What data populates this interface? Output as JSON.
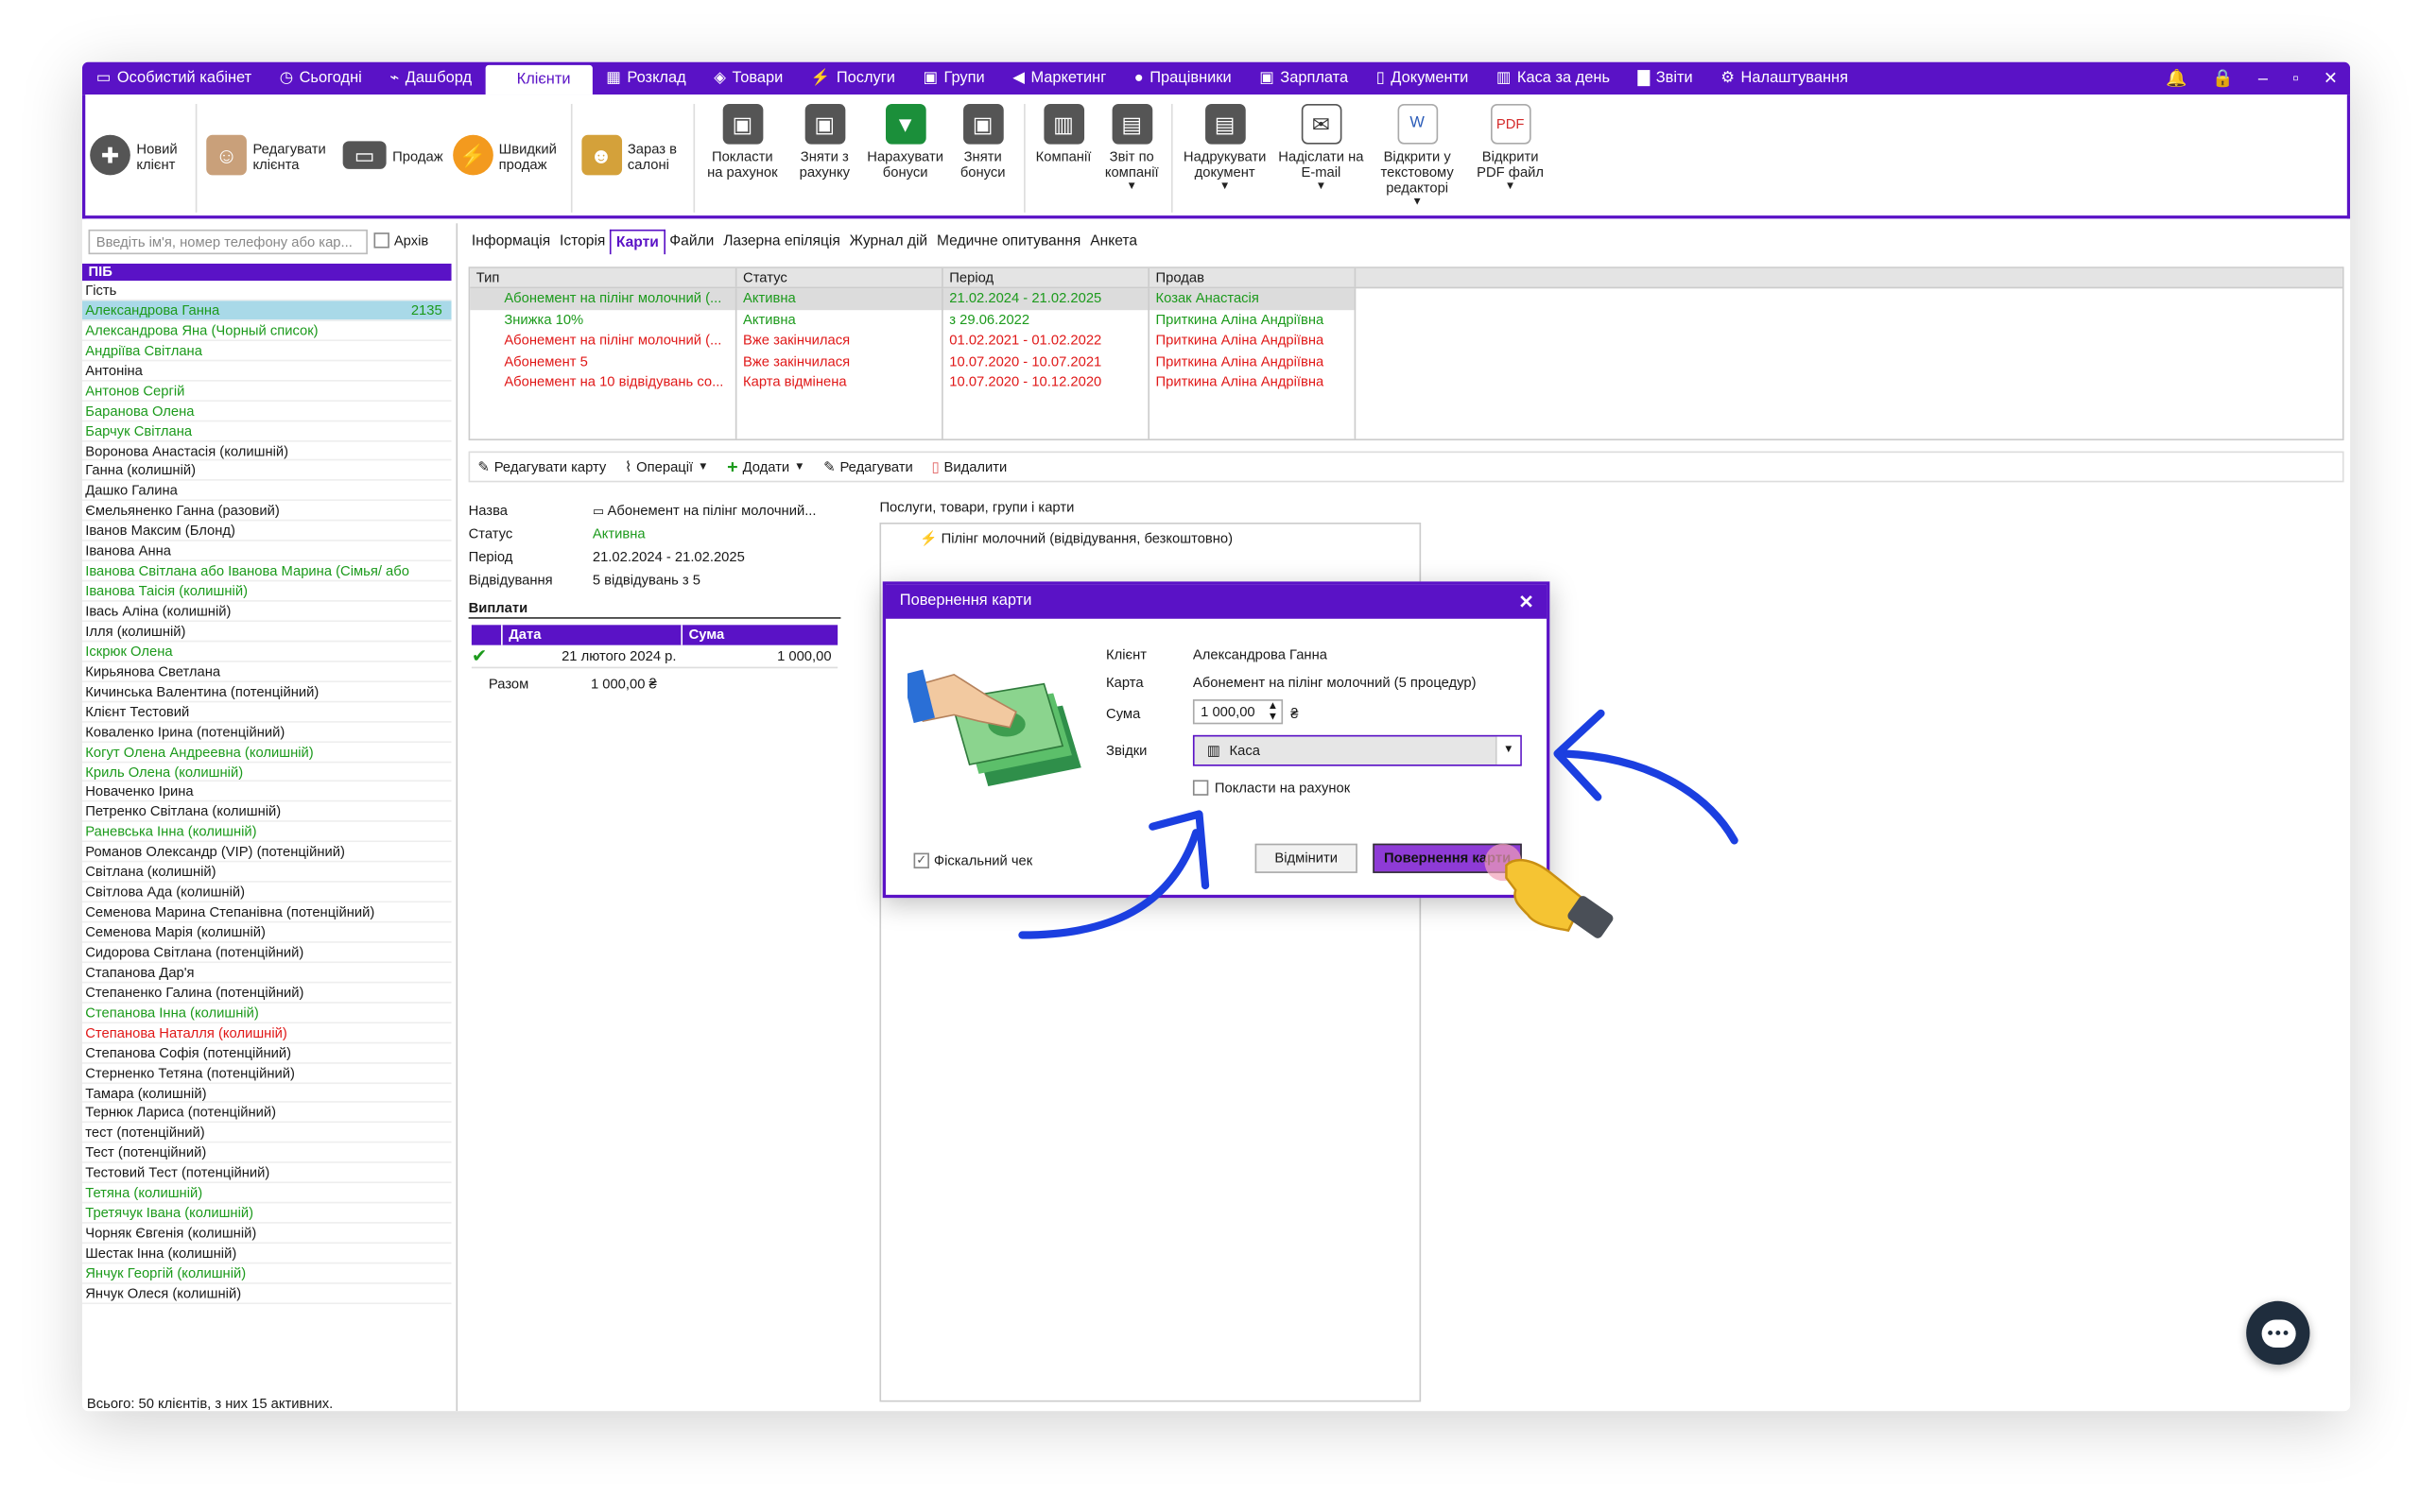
{
  "menubar": {
    "tabs": [
      {
        "label": "Особистий кабінет",
        "icon": "cabinet-icon",
        "glyph": "▭"
      },
      {
        "label": "Сьогодні",
        "icon": "clock-icon",
        "glyph": "◷"
      },
      {
        "label": "Дашборд",
        "icon": "pulse-icon",
        "glyph": "⌁"
      },
      {
        "label": "Клієнти",
        "icon": "",
        "glyph": "",
        "active": true
      },
      {
        "label": "Розклад",
        "icon": "calendar-icon",
        "glyph": "▦"
      },
      {
        "label": "Товари",
        "icon": "box-icon",
        "glyph": "◈"
      },
      {
        "label": "Послуги",
        "icon": "lightning-icon",
        "glyph": "⚡"
      },
      {
        "label": "Групи",
        "icon": "groups-icon",
        "glyph": "▣"
      },
      {
        "label": "Маркетинг",
        "icon": "megaphone-icon",
        "glyph": "◀"
      },
      {
        "label": "Працівники",
        "icon": "person-icon",
        "glyph": "●"
      },
      {
        "label": "Зарплата",
        "icon": "money-icon",
        "glyph": "▣"
      },
      {
        "label": "Документи",
        "icon": "document-icon",
        "glyph": "▯"
      },
      {
        "label": "Каса за день",
        "icon": "calculator-icon",
        "glyph": "▥"
      },
      {
        "label": "Звіти",
        "icon": "bar-chart-icon",
        "glyph": "▇"
      },
      {
        "label": "Налаштування",
        "icon": "gear-icon",
        "glyph": "⚙"
      }
    ],
    "window_controls": [
      "🔔",
      "🔒",
      "–",
      "▫",
      "✕"
    ]
  },
  "ribbon": {
    "new_client": "Новий клієнт",
    "edit_client": "Редагувати клієнта",
    "sale": "Продаж",
    "quick_sale": "Швидкий продаж",
    "in_salon": "Зараз в салоні",
    "put_on_account": "Покласти на рахунок",
    "withdraw_account": "Зняти з рахунку",
    "accrue_bonus": "Нарахувати бонуси",
    "withdraw_bonus": "Зняти бонуси",
    "companies": "Компанії",
    "companies_report": "Звіт по компанії",
    "print_document": "Надрукувати документ",
    "send_email": "Надіслати на E-mail",
    "open_text_editor": "Відкрити у текстовому редакторі",
    "open_pdf": "Відкрити PDF файл"
  },
  "sidebar": {
    "search_placeholder": "Введіть ім'я, номер телефону або кар...",
    "archive_label": "Архів",
    "header": "ПІБ",
    "clients": [
      {
        "name": "Гість",
        "color": "#1a1a1a"
      },
      {
        "name": "Александрова Ганна",
        "color": "#1c9a1c",
        "count": "2135",
        "selected": true
      },
      {
        "name": "Александрова Яна (Чорный список)",
        "color": "#1c9a1c"
      },
      {
        "name": "Андріїва Світлана",
        "color": "#1c9a1c"
      },
      {
        "name": "Антоніна",
        "color": "#1a1a1a"
      },
      {
        "name": "Антонов Сергій",
        "color": "#1c9a1c"
      },
      {
        "name": "Баранова Олена",
        "color": "#1c9a1c"
      },
      {
        "name": "Барчук Світлана",
        "color": "#1c9a1c"
      },
      {
        "name": "Воронова Анастасія (колишній)",
        "color": "#1a1a1a"
      },
      {
        "name": "Ганна (колишній)",
        "color": "#1a1a1a"
      },
      {
        "name": "Дашко Галина",
        "color": "#1a1a1a"
      },
      {
        "name": "Ємельяненко Ганна (разовий)",
        "color": "#1a1a1a"
      },
      {
        "name": "Іванов Максим (Блонд)",
        "color": "#1a1a1a"
      },
      {
        "name": "Іванова Анна",
        "color": "#1a1a1a"
      },
      {
        "name": "Іванова Світлана  або Іванова  Марина (Сімья/  або",
        "color": "#1c9a1c"
      },
      {
        "name": "Іванова Таісія (колишній)",
        "color": "#1c9a1c"
      },
      {
        "name": "Івась Аліна (колишній)",
        "color": "#1a1a1a"
      },
      {
        "name": "Ілля (колишній)",
        "color": "#1a1a1a"
      },
      {
        "name": "Іскрюк Олена",
        "color": "#1c9a1c"
      },
      {
        "name": "Кирьянова Светлана",
        "color": "#1a1a1a"
      },
      {
        "name": "Кичинська Валентина (потенційний)",
        "color": "#1a1a1a"
      },
      {
        "name": "Клієнт Тестовий",
        "color": "#1a1a1a"
      },
      {
        "name": "Коваленко Ірина (потенційний)",
        "color": "#1a1a1a"
      },
      {
        "name": "Когут Олена Андреевна (колишній)",
        "color": "#1c9a1c"
      },
      {
        "name": "Криль Олена (колишній)",
        "color": "#1c9a1c"
      },
      {
        "name": "Новаченко Ірина",
        "color": "#1a1a1a"
      },
      {
        "name": "Петренко Світлана (колишній)",
        "color": "#1a1a1a"
      },
      {
        "name": "Раневська Інна (колишній)",
        "color": "#1c9a1c"
      },
      {
        "name": "Романов Олександр (VIP) (потенційний)",
        "color": "#1a1a1a"
      },
      {
        "name": "Світлана (колишній)",
        "color": "#1a1a1a"
      },
      {
        "name": "Світлова Ада (колишній)",
        "color": "#1a1a1a"
      },
      {
        "name": "Семенова Марина Степанівна (потенційний)",
        "color": "#1a1a1a"
      },
      {
        "name": "Семенова Марія (колишній)",
        "color": "#1a1a1a"
      },
      {
        "name": "Сидорова Світлана (потенційний)",
        "color": "#1a1a1a"
      },
      {
        "name": "Стапанова Дар'я",
        "color": "#1a1a1a"
      },
      {
        "name": "Степаненко Галина (потенційний)",
        "color": "#1a1a1a"
      },
      {
        "name": "Степанова Інна (колишній)",
        "color": "#1c9a1c"
      },
      {
        "name": "Степанова Наталля (колишній)",
        "color": "#e01818"
      },
      {
        "name": "Степанова Софія (потенційний)",
        "color": "#1a1a1a"
      },
      {
        "name": "Стерненко Тетяна (потенційний)",
        "color": "#1a1a1a"
      },
      {
        "name": "Тамара (колишній)",
        "color": "#1a1a1a"
      },
      {
        "name": "Тернюк Лариса (потенційний)",
        "color": "#1a1a1a"
      },
      {
        "name": "тест (потенційний)",
        "color": "#1a1a1a"
      },
      {
        "name": "Тест (потенційний)",
        "color": "#1a1a1a"
      },
      {
        "name": "Тестовий Тест (потенційний)",
        "color": "#1a1a1a"
      },
      {
        "name": "Тетяна (колишній)",
        "color": "#1c9a1c"
      },
      {
        "name": "Третячук Івана (колишній)",
        "color": "#1c9a1c"
      },
      {
        "name": "Чорняк Євгенія (колишній)",
        "color": "#1a1a1a"
      },
      {
        "name": "Шестак Інна (колишній)",
        "color": "#1a1a1a"
      },
      {
        "name": "Янчук Георгій (колишній)",
        "color": "#1c9a1c"
      },
      {
        "name": "Янчук Олеся (колишній)",
        "color": "#1a1a1a"
      }
    ],
    "total": "Всього: 50 клієнтів, з них 15 активних."
  },
  "subtabs": [
    "Інформація",
    "Історія",
    "Карти",
    "Файли",
    "Лазерна епіляція",
    "Журнал дій",
    "Медичне опитування",
    "Анкета"
  ],
  "subtab_active": "Карти",
  "cards_table": {
    "headers": [
      "Тип",
      "Статус",
      "Період",
      "Продав"
    ],
    "rows": [
      {
        "type": "Абонемент на пілінг молочний (...",
        "status": "Активна",
        "period": "21.02.2024 - 21.02.2025",
        "seller": "Козак Анастасія",
        "color": "#1c9a1c",
        "selected": true
      },
      {
        "type": "Знижка 10%",
        "status": "Активна",
        "period": "з 29.06.2022",
        "seller": "Приткина Аліна Андріївна",
        "color": "#1c9a1c"
      },
      {
        "type": "Абонемент на пілінг молочний (...",
        "status": "Вже закінчилася",
        "period": "01.02.2021 - 01.02.2022",
        "seller": "Приткина Аліна Андріївна",
        "color": "#e01818"
      },
      {
        "type": "Абонемент 5",
        "status": "Вже закінчилася",
        "period": "10.07.2020 - 10.07.2021",
        "seller": "Приткина Аліна Андріївна",
        "color": "#e01818"
      },
      {
        "type": "Абонемент на 10 відвідувань со...",
        "status": "Карта відмінена",
        "period": "10.07.2020 - 10.12.2020",
        "seller": "Приткина Аліна Андріївна",
        "color": "#e01818"
      }
    ]
  },
  "card_toolbar": {
    "edit_card": "Редагувати карту",
    "operations": "Операції",
    "add": "Додати",
    "edit": "Редагувати",
    "delete": "Видалити"
  },
  "details": {
    "name_label": "Назва",
    "name_value": "Абонемент на пілінг молочний...",
    "status_label": "Статус",
    "status_value": "Активна",
    "period_label": "Період",
    "period_value": "21.02.2024 - 21.02.2025",
    "visits_label": "Відвідування",
    "visits_value": "5 відвідувань з 5"
  },
  "payments": {
    "title": "Виплати",
    "headers": [
      "Дата",
      "Сума"
    ],
    "rows": [
      {
        "date": "21 лютого 2024 р.",
        "amount": "1 000,00"
      }
    ],
    "total_label": "Разом",
    "total_value": "1 000,00 ₴"
  },
  "services": {
    "label": "Послуги, товари, групи і карти",
    "item": "Пілінг молочний (відвідування, безкоштовно)"
  },
  "modal": {
    "title": "Повернення карти",
    "client_label": "Клієнт",
    "client_value": "Александрова Ганна",
    "card_label": "Карта",
    "card_value": "Абонемент на пілінг молочний (5 процедур)",
    "sum_label": "Сума",
    "sum_value": "1 000,00",
    "currency": "₴",
    "source_label": "Звідки",
    "source_value": "Каса",
    "put_on_account": "Покласти на рахунок",
    "fiscal_check": "Фіскальний чек",
    "cancel": "Відмінити",
    "confirm": "Повернення карти"
  },
  "colors": {
    "accent": "#5a12c6",
    "active": "#1c9a1c",
    "expired": "#e01818",
    "arrow": "#1b3fe0"
  }
}
